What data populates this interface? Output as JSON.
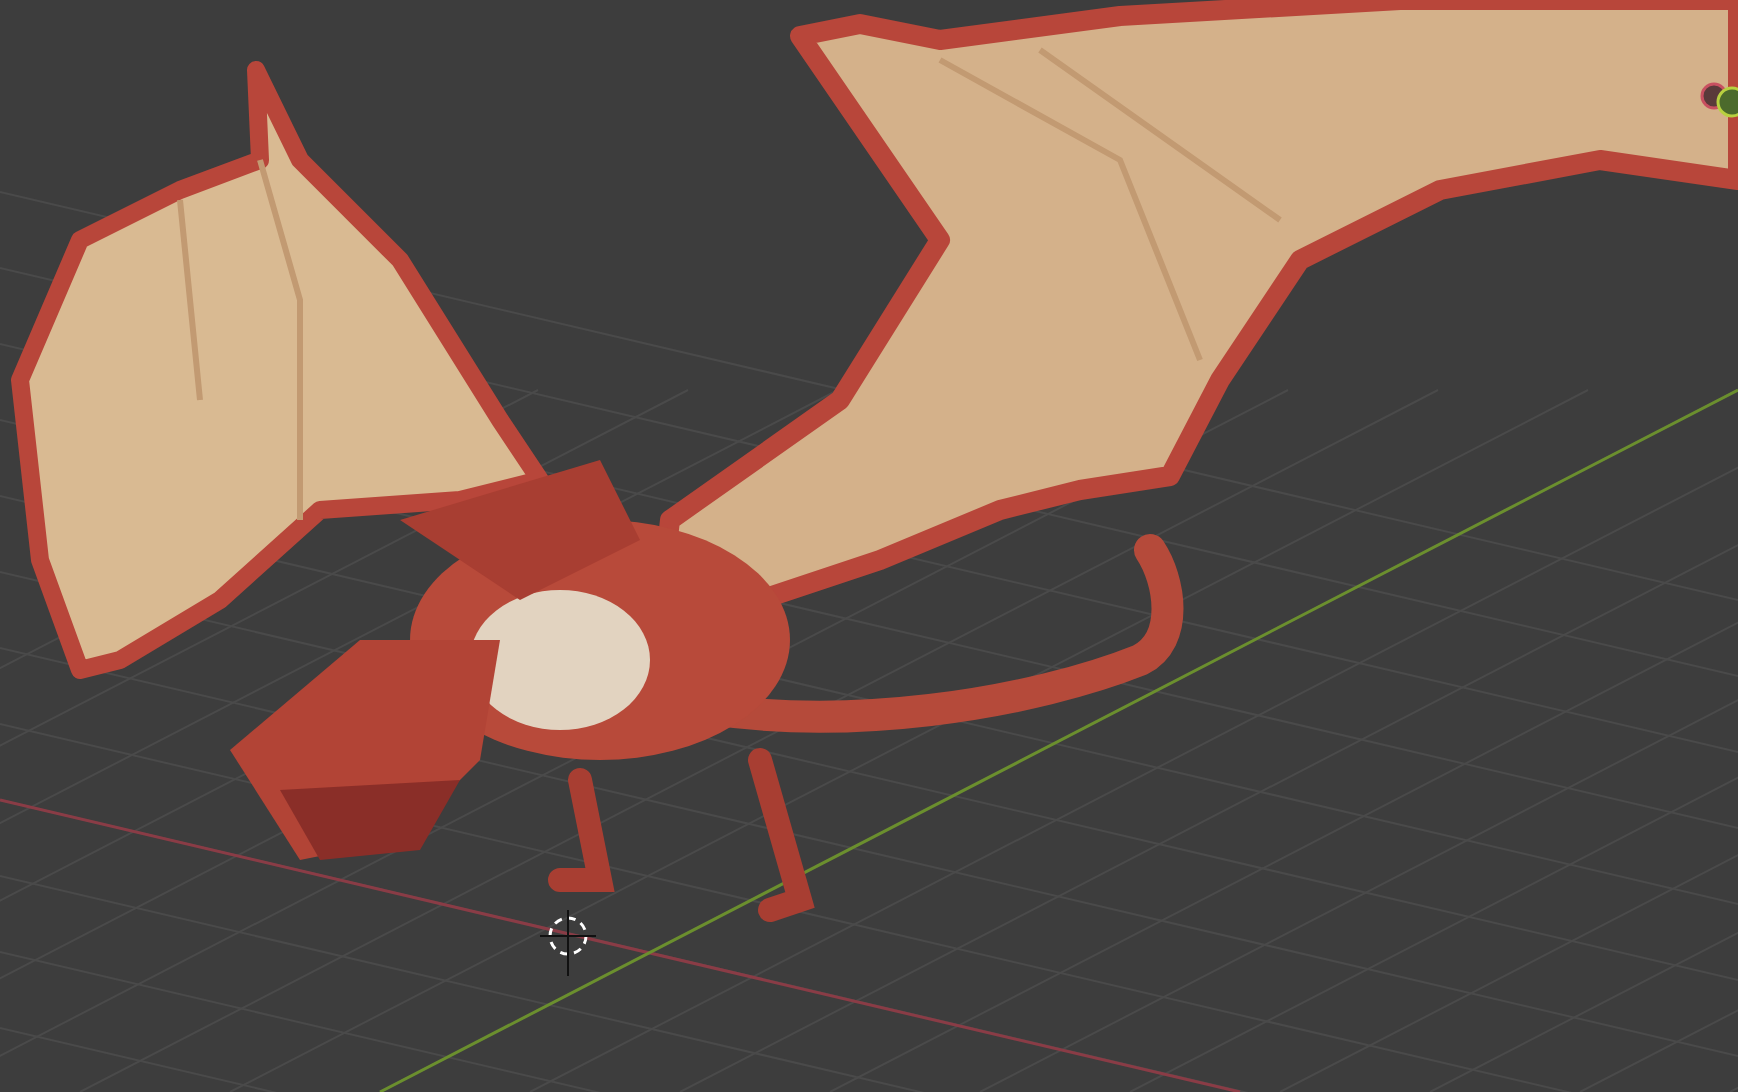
{
  "viewport": {
    "show_grid": true,
    "show_axes": true,
    "show_cursor": true,
    "show_gizmo": true
  }
}
